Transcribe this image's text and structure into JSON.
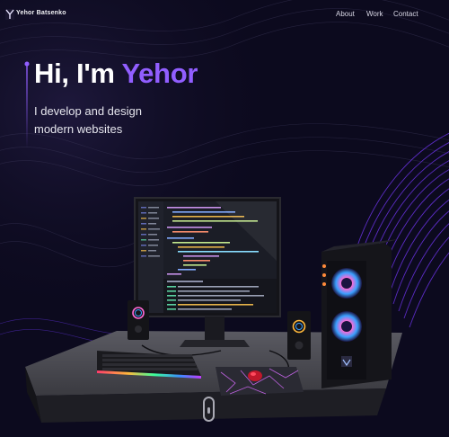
{
  "brand": {
    "logo_text": "Yehor Batsenko"
  },
  "nav": {
    "links": [
      {
        "label": "About"
      },
      {
        "label": "Work"
      },
      {
        "label": "Contact"
      }
    ]
  },
  "hero": {
    "greeting": "Hi, I'm",
    "name": "Yehor",
    "subtitle_line1": "I develop and design",
    "subtitle_line2": "modern websites"
  },
  "colors": {
    "background": "#0c0a1e",
    "accent": "#915eff",
    "text": "#ffffff"
  },
  "icons": [
    "logo-mark",
    "scroll-indicator"
  ]
}
